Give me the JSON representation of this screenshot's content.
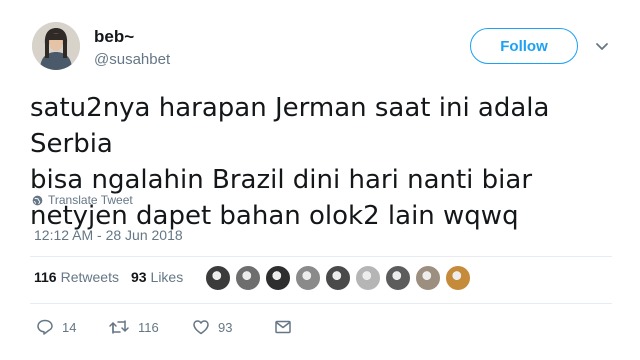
{
  "user": {
    "display_name": "beb~",
    "handle": "@susahbet"
  },
  "follow_label": "Follow",
  "tweet": {
    "lines": [
      "satu2nya harapan Jerman saat ini adala Serbia",
      "bisa ngalahin Brazil dini hari nanti biar",
      "netyjen dapet bahan olok2 lain wqwq"
    ]
  },
  "translate_label": "Translate Tweet",
  "timestamp": "12:12 AM - 28 Jun 2018",
  "stats": {
    "retweets_count": "116",
    "retweets_label": "Retweets",
    "likes_count": "93",
    "likes_label": "Likes"
  },
  "likers": [
    {
      "color": "#3b3b3b"
    },
    {
      "color": "#6e6e6e"
    },
    {
      "color": "#2e2e2e"
    },
    {
      "color": "#8a8a8a"
    },
    {
      "color": "#4a4a4a"
    },
    {
      "color": "#b5b5b5"
    },
    {
      "color": "#5c5c5c"
    },
    {
      "color": "#9c8f80"
    },
    {
      "color": "#c58a3a"
    }
  ],
  "actions": {
    "reply_count": "14",
    "retweet_count": "116",
    "like_count": "93"
  },
  "colors": {
    "accent": "#1da1f2",
    "secondary_text": "#657786",
    "divider": "#e6ecf0"
  }
}
